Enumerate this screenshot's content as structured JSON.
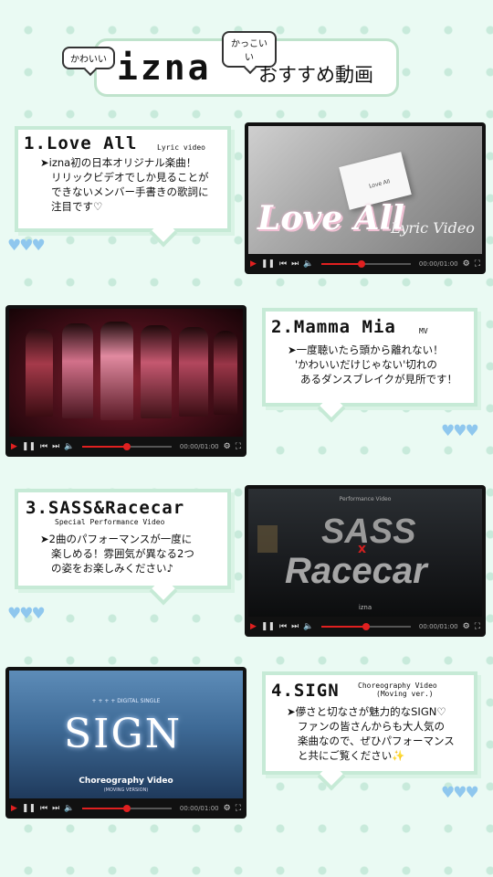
{
  "header": {
    "tag_left": "かわいい",
    "tag_right": "かっこいい",
    "brand": "izna",
    "subtitle": "おすすめ動画"
  },
  "items": [
    {
      "title": "1.Love All",
      "subtitle": "Lyric video",
      "desc": [
        "➤izna初の日本オリジナル楽曲！",
        "リリックビデオでしか見ることが",
        "できないメンバー手書きの歌詞に",
        "注目です♡"
      ],
      "overlay_title": "Love All",
      "overlay_sub": "Lyric Video",
      "overlay_small": "Love All",
      "time": "00:00/01:00",
      "progress": 0.45
    },
    {
      "title": "2.Mamma Mia",
      "subtitle": "MV",
      "desc": [
        "➤一度聴いたら頭から離れない！",
        "'かわいいだけじゃない'切れの",
        "あるダンスブレイクが見所です！"
      ],
      "time": "00:00/01:00",
      "progress": 0.5
    },
    {
      "title": "3.SASS&Racecar",
      "subtitle": "Special Performance Video",
      "desc": [
        "➤2曲のパフォーマンスが一度に",
        "楽しめる！雰囲気が異なる2つ",
        "の姿をお楽しみください♪"
      ],
      "overlay_top": "Performance Video",
      "overlay_line1": "SASS",
      "overlay_x": "x",
      "overlay_line2": "Racecar",
      "overlay_logo": "izna",
      "time": "00:00/01:00",
      "progress": 0.5
    },
    {
      "title": "4.SIGN",
      "subtitle": "Choreography Video",
      "subtitle2": "(Moving ver.)",
      "desc": [
        "➤儚さと切なさが魅力的なSIGN♡",
        "ファンの皆さんからも大人気の",
        "楽曲なので、ぜひパフォーマンス",
        "と共にご覧ください✨"
      ],
      "overlay_top": "+ + + + DIGITAL SINGLE",
      "overlay_title": "SIGN",
      "overlay_sub": "Choreography Video",
      "overlay_sub2": "(MOVING VERSION)",
      "time": "00:00/01:00",
      "progress": 0.5
    }
  ],
  "hearts": "♥♥♥",
  "colors": {
    "accent": "#e02020",
    "bubble_border": "#c6ead6",
    "heart": "#8fc7ee"
  }
}
